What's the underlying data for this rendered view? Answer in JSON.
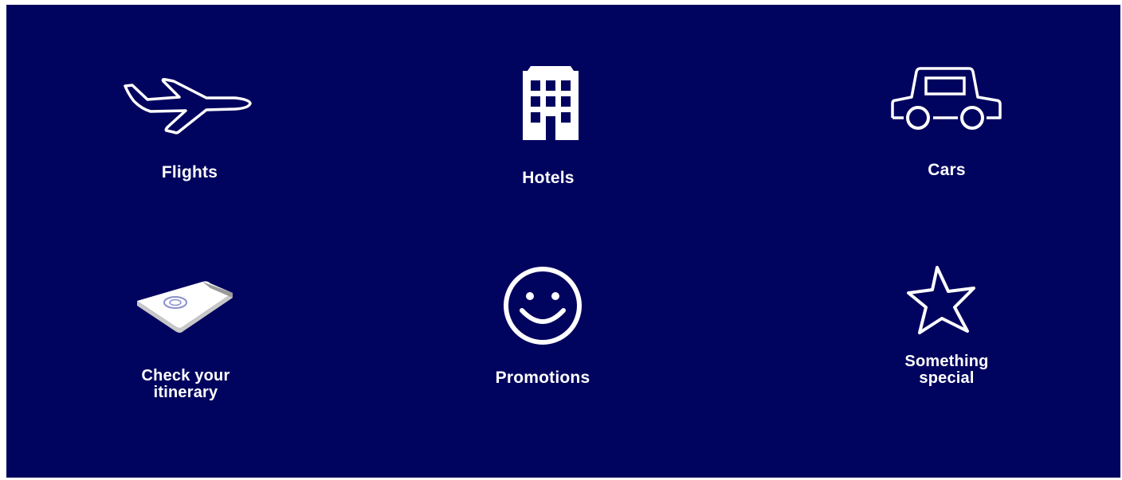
{
  "menu": {
    "background_color": "#01045e",
    "text_color": "#ffffff",
    "items": [
      {
        "id": "flights",
        "label": "Flights",
        "icon": "airplane-icon"
      },
      {
        "id": "hotels",
        "label": "Hotels",
        "icon": "hotel-building-icon"
      },
      {
        "id": "cars",
        "label": "Cars",
        "icon": "car-icon"
      },
      {
        "id": "itinerary",
        "label": "Check your itinerary",
        "label_line1": "Check your",
        "label_line2": "itinerary",
        "icon": "itinerary-booklet-icon"
      },
      {
        "id": "promotions",
        "label": "Promotions",
        "icon": "smiley-face-icon"
      },
      {
        "id": "special",
        "label": "Something special",
        "label_line1": "Something",
        "label_line2": "special",
        "icon": "star-icon"
      }
    ]
  }
}
